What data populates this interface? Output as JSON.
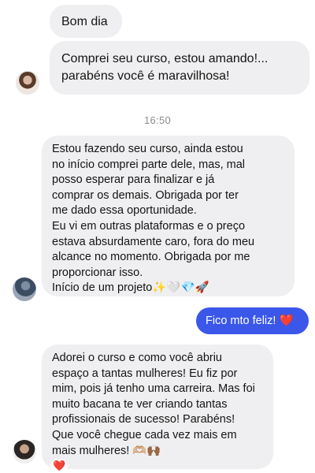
{
  "messages": [
    {
      "text": "Bom dia"
    },
    {
      "text": "Comprei seu curso, estou amando!... parabéns você é maravilhosa!"
    },
    {
      "text": "Estou fazendo seu curso, ainda estou\nno início comprei parte dele, mas, mal\nposso esperar para finalizar e já\ncomprar os demais. Obrigada por ter\nme dado essa oportunidade.\nEu vi em outras plataformas e o preço\nestava absurdamente caro, fora do meu\nalcance no momento. Obrigada por me\nproporcionar isso.\nInício de um projeto✨🤍💎🚀"
    },
    {
      "text": "Adorei o curso e como você abriu\nespaço a tantas mulheres! Eu fiz por\nmim, pois já tenho uma carreira. Mas foi\nmuito bacana te ver criando tantas\nprofissionais de sucesso! Parabéns!\nQue você chegue cada vez mais em\nmais mulheres! 🫶🏼🙌🏾"
    }
  ],
  "timestamp": "16:50",
  "outgoing": {
    "text": "Fico mto feliz!",
    "emoji": "❤️"
  },
  "reaction": "❤️",
  "colors": {
    "incoming_bg": "#efeff1",
    "outgoing_bg": "#3b57ea",
    "heart": "#e0242b"
  }
}
